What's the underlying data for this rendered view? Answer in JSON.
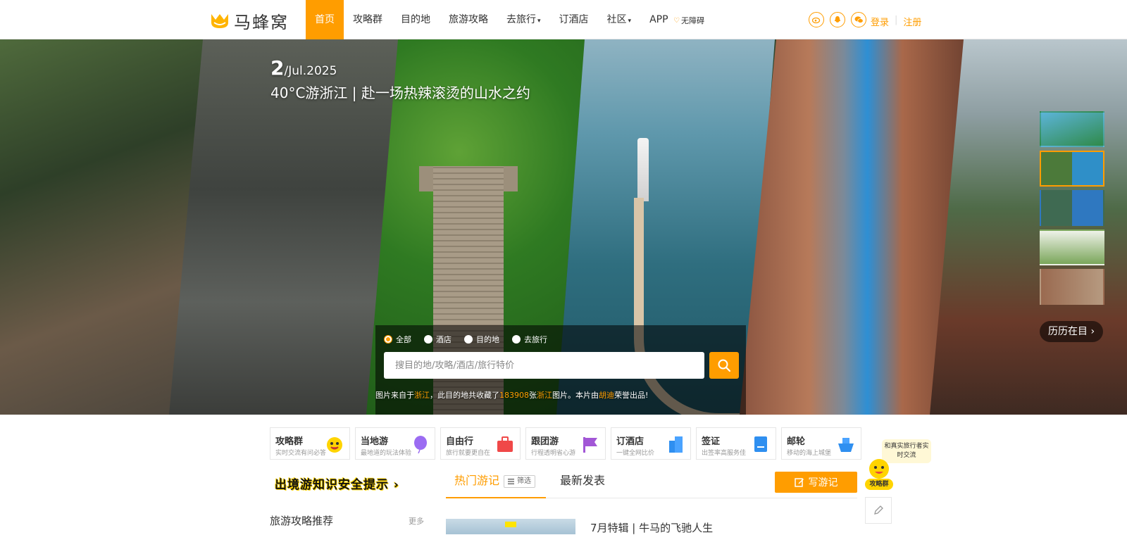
{
  "header": {
    "logo_text": "马蜂窝",
    "nav": [
      {
        "label": "首页",
        "active": true
      },
      {
        "label": "攻略群"
      },
      {
        "label": "目的地"
      },
      {
        "label": "旅游攻略"
      },
      {
        "label": "去旅行",
        "dropdown": true
      },
      {
        "label": "订酒店"
      },
      {
        "label": "社区",
        "dropdown": true
      },
      {
        "label": "APP"
      }
    ],
    "barrier_free": "无障碍",
    "login": "登录",
    "register": "注册",
    "social_icons": [
      "weibo-icon",
      "qq-icon",
      "wechat-icon"
    ],
    "accent_color": "#ff9d00"
  },
  "banner": {
    "day": "2",
    "month_year": "/Jul.2025",
    "title": "40°C游浙江 | 赴一场热辣滚烫的山水之约",
    "history_button": "历历在目 ›",
    "search": {
      "options": [
        {
          "label": "全部",
          "checked": true
        },
        {
          "label": "酒店"
        },
        {
          "label": "目的地"
        },
        {
          "label": "去旅行"
        }
      ],
      "placeholder": "搜目的地/攻略/酒店/旅行特价"
    },
    "credit": {
      "p1": "图片来自于",
      "place1": "浙江",
      "p2": "，此目的地共收藏了",
      "count": "183908",
      "p3": "张",
      "place2": "浙江",
      "p4": "图片。本片由",
      "author": "胡迪",
      "p5": "荣誉出品!"
    }
  },
  "services": [
    {
      "title": "攻略群",
      "subtitle": "实时交流有问必答",
      "icon": "emoji-mascot-icon",
      "color": "#ffd400"
    },
    {
      "title": "当地游",
      "subtitle": "最地道的玩法体验",
      "icon": "balloon-icon",
      "color": "#9b6cf2"
    },
    {
      "title": "自由行",
      "subtitle": "旅行就要更自在",
      "icon": "suitcase-icon",
      "color": "#f04848"
    },
    {
      "title": "跟团游",
      "subtitle": "行程透明省心游",
      "icon": "flag-icon",
      "color": "#a257d6"
    },
    {
      "title": "订酒店",
      "subtitle": "一键全网比价",
      "icon": "building-icon",
      "color": "#2f8ff0"
    },
    {
      "title": "签证",
      "subtitle": "出签率高服务佳",
      "icon": "passport-icon",
      "color": "#2f8ff0"
    },
    {
      "title": "邮轮",
      "subtitle": "移动的海上城堡",
      "icon": "ship-icon",
      "color": "#2f8ff0"
    }
  ],
  "main": {
    "safety_banner": "出境游知识安全提示",
    "recommend_title": "旅游攻略推荐",
    "recommend_more": "更多",
    "tab_hot": "热门游记",
    "filter": "筛选",
    "tab_new": "最新发表",
    "write_button": "写游记",
    "first_post_title": "7月特辑 | 牛马的飞驰人生"
  },
  "floating": {
    "bubble": "和真实旅行者实时交流",
    "label": "攻略群"
  }
}
